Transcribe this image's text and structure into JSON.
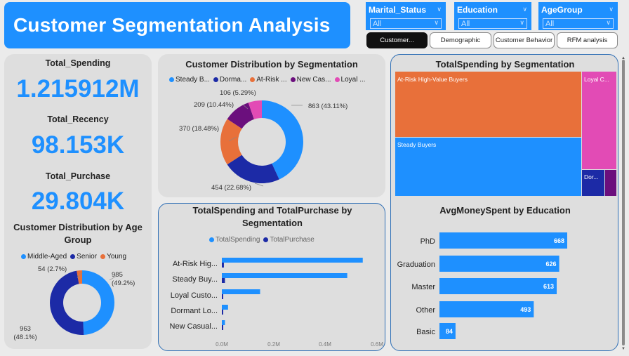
{
  "header": {
    "title": "Customer Segmentation Analysis"
  },
  "slicers": [
    {
      "label": "Marital_Status",
      "value": "All"
    },
    {
      "label": "Education",
      "value": "All"
    },
    {
      "label": "AgeGroup",
      "value": "All"
    }
  ],
  "nav": [
    {
      "label": "Customer...",
      "active": true
    },
    {
      "label": "Demographic",
      "active": false
    },
    {
      "label": "Customer Behavior",
      "active": false
    },
    {
      "label": "RFM analysis",
      "active": false
    }
  ],
  "kpis": {
    "spending_label": "Total_Spending",
    "spending_value": "1.215912M",
    "recency_label": "Total_Recency",
    "recency_value": "98.153K",
    "purchase_label": "Total_Purchase",
    "purchase_value": "29.804K"
  },
  "colors": {
    "accent": "#1e90ff",
    "navy": "#1c2aa6",
    "orange": "#e8703a",
    "purple": "#6b0f7d",
    "pink": "#e24bb5"
  },
  "charts": {
    "age": {
      "title": "Customer Distribution by Age Group",
      "legend": [
        "Middle-Aged",
        "Senior",
        "Young"
      ],
      "labels": [
        "985",
        "(49.2%)",
        "963",
        "(48.1%)",
        "54 (2.7%)"
      ]
    },
    "segment_donut": {
      "title": "Customer Distribution by Segmentation",
      "legend": [
        "Steady B...",
        "Dorma...",
        "At-Risk ...",
        "New Cas...",
        "Loyal ..."
      ],
      "labels": [
        "863 (43.11%)",
        "454 (22.68%)",
        "370 (18.48%)",
        "209 (10.44%)",
        "106 (5.29%)"
      ]
    },
    "bars": {
      "title_line1": "TotalSpending and TotalPurchase by",
      "title_line2": "Segmentation",
      "legend": [
        "TotalSpending",
        "TotalPurchase"
      ],
      "categories": [
        "At-Risk Hig...",
        "Steady Buy...",
        "Loyal Custo...",
        "Dormant Lo...",
        "New Casual..."
      ],
      "ticks": [
        "0.0M",
        "0.2M",
        "0.4M",
        "0.6M"
      ]
    },
    "treemap": {
      "title": "TotalSpending by Segmentation",
      "labels": [
        "At-Risk High-Value Buyers",
        "Steady Buyers",
        "Loyal C...",
        "Dor..."
      ]
    },
    "education": {
      "title": "AvgMoneySpent by Education",
      "categories": [
        "PhD",
        "Graduation",
        "Master",
        "Other",
        "Basic"
      ],
      "value_labels": [
        "668",
        "626",
        "613",
        "493",
        "84"
      ]
    }
  },
  "chart_data": [
    {
      "type": "pie",
      "title": "Customer Distribution by Age Group",
      "categories": [
        "Middle-Aged",
        "Senior",
        "Young"
      ],
      "values": [
        985,
        963,
        54
      ],
      "percents": [
        49.2,
        48.1,
        2.7
      ],
      "colors": [
        "#1e90ff",
        "#1c2aa6",
        "#e8703a"
      ],
      "legend": "top"
    },
    {
      "type": "pie",
      "title": "Customer Distribution by Segmentation",
      "categories": [
        "Steady B...",
        "Dorma...",
        "At-Risk ...",
        "New Cas...",
        "Loyal ..."
      ],
      "values": [
        863,
        454,
        370,
        209,
        106
      ],
      "percents": [
        43.11,
        22.68,
        18.48,
        10.44,
        5.29
      ],
      "colors": [
        "#1e90ff",
        "#1c2aa6",
        "#e8703a",
        "#6b0f7d",
        "#e24bb5"
      ],
      "legend": "top"
    },
    {
      "type": "bar",
      "orientation": "horizontal",
      "title": "TotalSpending and TotalPurchase by Segmentation",
      "categories": [
        "At-Risk Hig...",
        "Steady Buy...",
        "Loyal Custo...",
        "Dormant Lo...",
        "New Casual..."
      ],
      "series": [
        {
          "name": "TotalSpending",
          "values": [
            0.545,
            0.485,
            0.148,
            0.024,
            0.012
          ],
          "color": "#1e90ff"
        },
        {
          "name": "TotalPurchase",
          "values": [
            0.008,
            0.012,
            0.004,
            0.003,
            0.002
          ],
          "color": "#1c2aa6"
        }
      ],
      "xlim": [
        0,
        0.6
      ],
      "x_ticks": [
        "0.0M",
        "0.2M",
        "0.4M",
        "0.6M"
      ],
      "legend": "top"
    },
    {
      "type": "treemap",
      "title": "TotalSpending by Segmentation",
      "categories": [
        "At-Risk High-Value Buyers",
        "Steady Buyers",
        "Loyal C...",
        "Dor...",
        ""
      ],
      "values": [
        0.545,
        0.485,
        0.148,
        0.024,
        0.012
      ],
      "colors": [
        "#e8703a",
        "#1e90ff",
        "#e24bb5",
        "#1c2aa6",
        "#6b0f7d"
      ]
    },
    {
      "type": "bar",
      "orientation": "horizontal",
      "title": "AvgMoneySpent by Education",
      "categories": [
        "PhD",
        "Graduation",
        "Master",
        "Other",
        "Basic"
      ],
      "values": [
        668,
        626,
        613,
        493,
        84
      ],
      "color": "#1e90ff"
    }
  ]
}
